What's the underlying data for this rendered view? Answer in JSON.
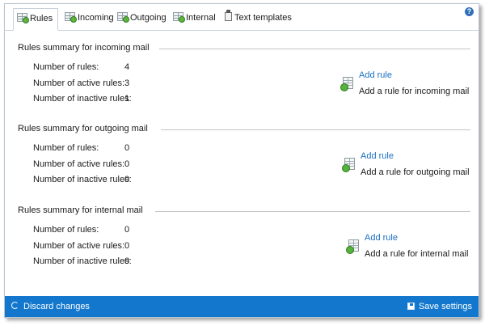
{
  "tabs": [
    {
      "label": "Rules",
      "icon": "rules-icon",
      "active": true
    },
    {
      "label": "Incoming",
      "icon": "incoming-icon",
      "active": false
    },
    {
      "label": "Outgoing",
      "icon": "outgoing-icon",
      "active": false
    },
    {
      "label": "Internal",
      "icon": "internal-icon",
      "active": false
    },
    {
      "label": "Text templates",
      "icon": "text-templates-icon",
      "active": false
    }
  ],
  "help": {
    "label": "?"
  },
  "sections": [
    {
      "title": "Rules summary for incoming mail",
      "stats": [
        {
          "label": "Number of rules:",
          "value": "4"
        },
        {
          "label": "Number of active rules:",
          "value": "3"
        },
        {
          "label": "Number of inactive rules:",
          "value": "1"
        }
      ],
      "add_link": "Add rule",
      "add_desc": "Add a rule for incoming mail"
    },
    {
      "title": "Rules summary for outgoing mail",
      "stats": [
        {
          "label": "Number of rules:",
          "value": "0"
        },
        {
          "label": "Number of active rules:",
          "value": "0"
        },
        {
          "label": "Number of inactive rules:",
          "value": "0"
        }
      ],
      "add_link": "Add rule",
      "add_desc": "Add a rule for outgoing mail"
    },
    {
      "title": "Rules summary for internal mail",
      "stats": [
        {
          "label": "Number of rules:",
          "value": "0"
        },
        {
          "label": "Number of active rules:",
          "value": "0"
        },
        {
          "label": "Number of inactive rules:",
          "value": "0"
        }
      ],
      "add_link": "Add rule",
      "add_desc": "Add a rule for internal mail"
    }
  ],
  "footer": {
    "discard_label": "Discard changes",
    "save_label": "Save settings"
  },
  "colors": {
    "accent": "#1378cd",
    "link": "#1b6fc2"
  }
}
